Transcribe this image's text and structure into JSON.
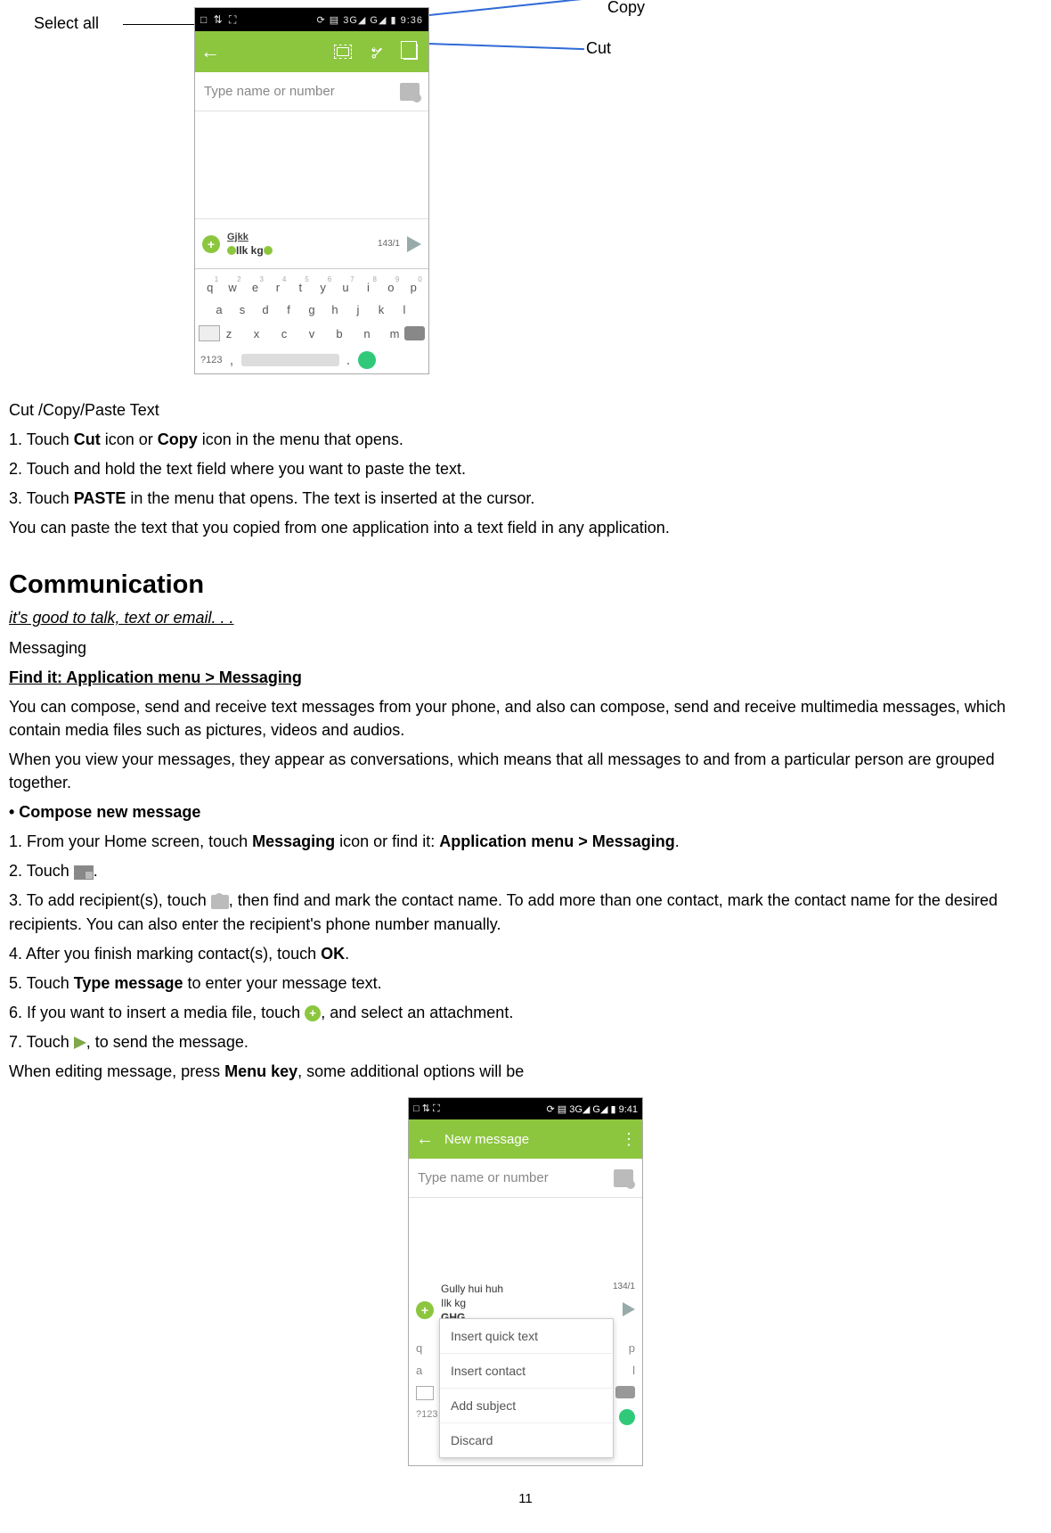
{
  "annotations": {
    "select_all": "Select all",
    "copy": "Copy",
    "cut": "Cut"
  },
  "phone1": {
    "status_left": "□ ⇅ ⛶",
    "status_right": "⟳ ▤ 3G◢ G◢ ▮ 9:36",
    "recipient_placeholder": "Type name or number",
    "msg_line1": "Gjkk",
    "msg_line2": "Ilk kg",
    "count": "143/1",
    "kb_row1": [
      "q",
      "w",
      "e",
      "r",
      "t",
      "y",
      "u",
      "i",
      "o",
      "p"
    ],
    "kb_nums": [
      "1",
      "2",
      "3",
      "4",
      "5",
      "6",
      "7",
      "8",
      "9",
      "0"
    ],
    "kb_row2": [
      "a",
      "s",
      "d",
      "f",
      "g",
      "h",
      "j",
      "k",
      "l"
    ],
    "kb_row3": [
      "z",
      "x",
      "c",
      "v",
      "b",
      "n",
      "m"
    ],
    "sym": "?123"
  },
  "section1": {
    "title": "Cut /Copy/Paste Text",
    "s1a": "1. Touch ",
    "s1b": "Cut",
    "s1c": " icon or ",
    "s1d": "Copy",
    "s1e": " icon in the menu that opens.",
    "s2": "2. Touch and hold the text field where you want to paste the text.",
    "s3a": "3. Touch ",
    "s3b": "PASTE",
    "s3c": " in the menu that opens. The text is inserted at the cursor.",
    "s4": "You can paste the text that you copied from one application into a text field in any application."
  },
  "communication": {
    "heading": "Communication",
    "subtitle": "it's good to talk, text or email. . .",
    "messaging_label": "Messaging",
    "findit": "Find it: Application menu > Messaging",
    "p1": "You can compose, send and receive text messages from your phone, and also can compose, send and receive multimedia messages, which contain media files such as pictures, videos and audios.",
    "p2": "When you view your messages, they appear as conversations, which means that all messages to and from a particular person are grouped together.",
    "bullet": "• Compose new message",
    "c1a": "1. From your Home screen, touch ",
    "c1b": "Messaging",
    "c1c": " icon or find it: ",
    "c1d": "Application menu > Messaging",
    "c1e": ".",
    "c2a": "2. Touch ",
    "c2b": ".",
    "c3a": "3. To add recipient(s), touch ",
    "c3b": ", then find and mark the contact name. To add more than one contact, mark the contact name for the desired recipients. You can also enter the recipient's phone number manually.",
    "c4a": "4. After you finish marking contact(s), touch ",
    "c4b": "OK",
    "c4c": ".",
    "c5a": "5. Touch ",
    "c5b": "Type message",
    "c5c": " to enter your message text.",
    "c6a": "6. If you want to insert a media file, touch ",
    "c6b": ", and select an attachment.",
    "c7a": "7. Touch ",
    "c7b": ", to send the message.",
    "c8a": "When editing message, press ",
    "c8b": "Menu key",
    "c8c": ", some additional options will be"
  },
  "phone2": {
    "status_left": "□ ⇅ ⛶",
    "status_right": "⟳ ▤ 3G◢ G◢ ▮ 9:41",
    "title": "New message",
    "recipient_placeholder": "Type name or number",
    "typed1": "Gully hui huh",
    "typed2": "Ilk kg",
    "typed3": "GHG",
    "count": "134/1",
    "menu": [
      "Insert quick text",
      "Insert contact",
      "Add subject",
      "Discard"
    ],
    "q": "q",
    "p": "p"
  },
  "page": "11"
}
